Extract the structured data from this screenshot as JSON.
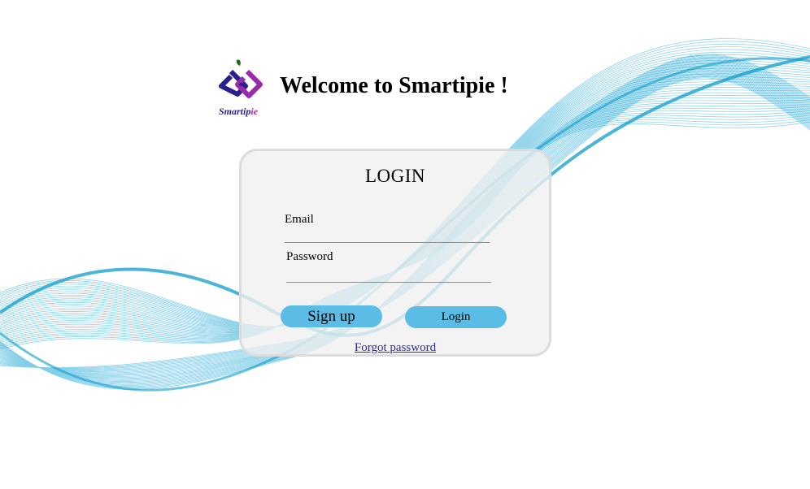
{
  "header": {
    "brand_prefix": "Smartip",
    "brand_suffix": "ie",
    "welcome": "Welcome to Smartipie !"
  },
  "login_card": {
    "title": "LOGIN",
    "email_label": "Email",
    "email_value": "",
    "password_label": "Password",
    "password_value": "",
    "signup_label": "Sign up",
    "login_label": "Login",
    "forgot_label": "Forgot password"
  },
  "colors": {
    "wave": "#1fa7d6",
    "button": "#5bbde5",
    "link": "#2c2ca8",
    "logo_blue": "#2a1f8f",
    "logo_purple": "#b02aa8"
  }
}
